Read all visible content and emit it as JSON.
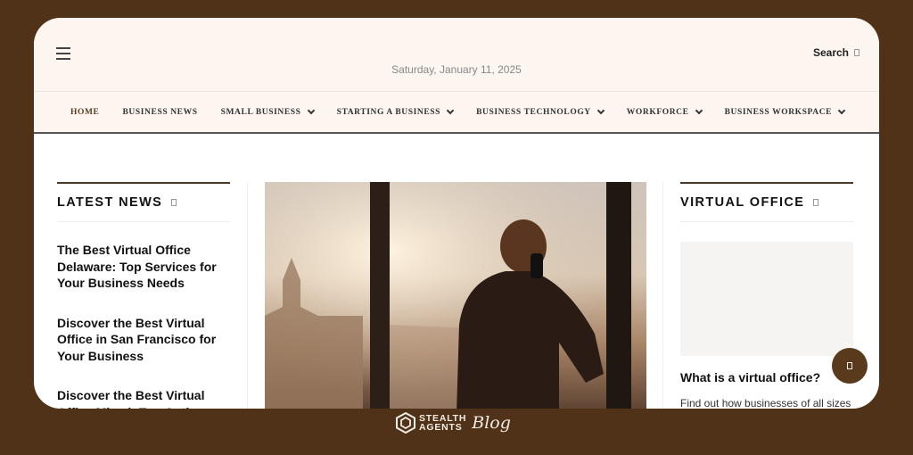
{
  "header": {
    "date": "Saturday, January 11, 2025",
    "search_label": "Search",
    "menu_icon": "hamburger-icon"
  },
  "nav": [
    {
      "label": "HOME",
      "dropdown": false
    },
    {
      "label": "BUSINESS NEWS",
      "dropdown": false
    },
    {
      "label": "SMALL BUSINESS",
      "dropdown": true
    },
    {
      "label": "STARTING A BUSINESS",
      "dropdown": true
    },
    {
      "label": "BUSINESS TECHNOLOGY",
      "dropdown": true
    },
    {
      "label": "WORKFORCE",
      "dropdown": true
    },
    {
      "label": "BUSINESS WORKSPACE",
      "dropdown": true
    }
  ],
  "latest_news": {
    "title": "LATEST NEWS",
    "items": [
      "The Best Virtual Office Delaware: Top Services for Your Business Needs",
      "Discover the Best Virtual Office in San Francisco for Your Business",
      "Discover the Best Virtual Office Miami: Top Options for"
    ]
  },
  "virtual_office": {
    "title": "VIRTUAL OFFICE",
    "question": "What is a virtual office?",
    "teaser": "Find out how businesses of all sizes"
  },
  "footer": {
    "logo_line1": "STEALTH",
    "logo_line2": "AGENTS",
    "logo_script": "Blog"
  },
  "colors": {
    "frame": "#4f3217",
    "header_bg": "#fcf5f0",
    "accent": "#5a3a1c"
  }
}
